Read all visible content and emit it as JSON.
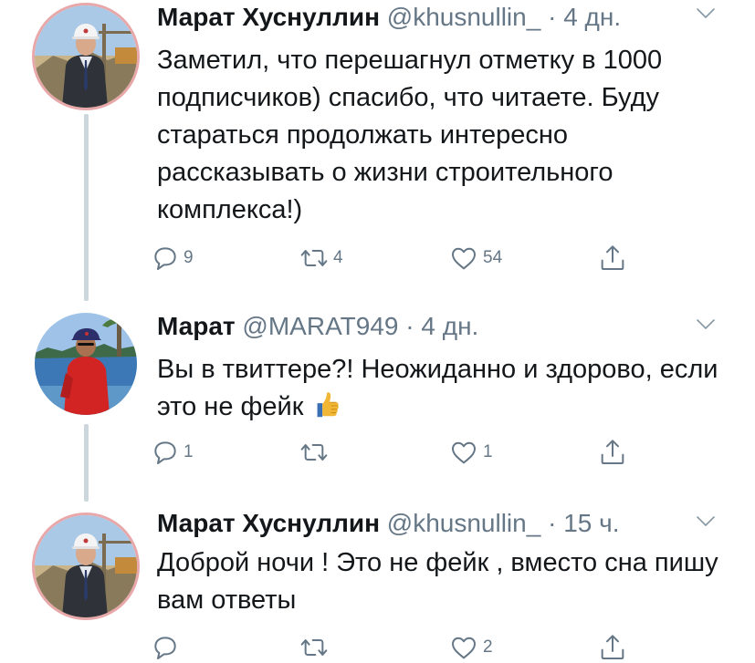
{
  "tweets": [
    {
      "name": "Марат Хуснуллин",
      "handle": "@khusnullin_",
      "dot": "·",
      "time": "4 дн.",
      "text": "Заметил, что перешагнул отметку в 1000 подписчиков) спасибо, что читаете. Буду стараться продолжать интересно рассказывать о жизни строительного комплекса!)",
      "replies": "9",
      "retweets": "4",
      "likes": "54"
    },
    {
      "name": "Марат",
      "handle": "@MARAT949",
      "dot": "·",
      "time": "4 дн.",
      "text": "Вы в твиттере?! Неожиданно и здорово, если это не фейк",
      "emoji": "thumbs-up",
      "replies": "1",
      "retweets": "",
      "likes": "1"
    },
    {
      "name": "Марат Хуснуллин",
      "handle": "@khusnullin_",
      "dot": "·",
      "time": "15 ч.",
      "text": "Доброй ночи ! Это не фейк , вместо сна пишу вам ответы",
      "replies": "",
      "retweets": "",
      "likes": "2"
    }
  ],
  "icons": {
    "reply": "reply-icon",
    "retweet": "retweet-icon",
    "like": "heart-icon",
    "share": "share-icon",
    "menu": "chevron-down-icon"
  },
  "colors": {
    "name": "#14171a",
    "secondary": "#657786",
    "thread_line": "#ccd6dd"
  }
}
